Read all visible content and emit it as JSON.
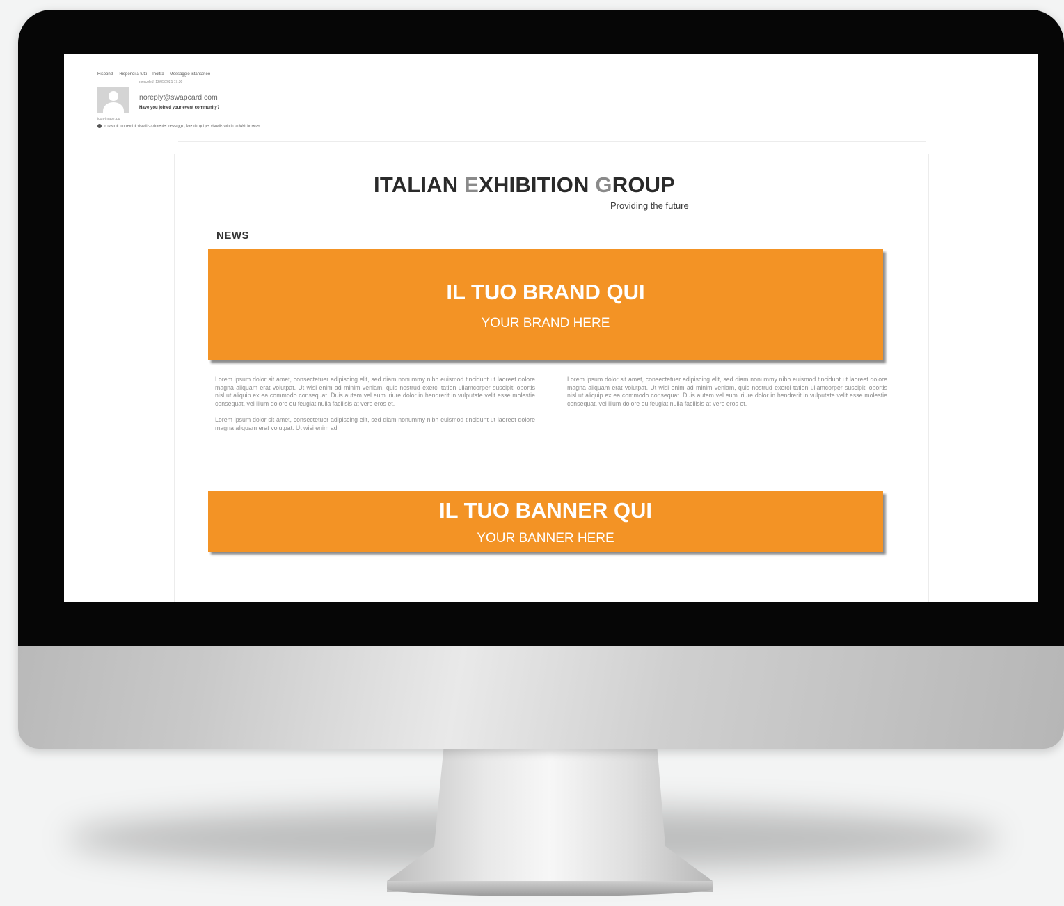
{
  "mail": {
    "toolbar": [
      "Rispondi",
      "Rispondi a tutti",
      "Inoltra",
      "Messaggio istantaneo"
    ],
    "date": "mercoledì 12/05/2021 17:30",
    "sender": "noreply@swapcard.com",
    "subject": "Have you joined your event community?",
    "attachment": "icon-image.jpg",
    "info": "In caso di problemi di visualizzazione del messaggio, fare clic qui per visualizzarlo in un Web browser."
  },
  "newsletter": {
    "logo": {
      "part1": "ITALIAN ",
      "letter_e": "E",
      "part2": "XHIBITION ",
      "letter_g": "G",
      "part3": "ROUP",
      "tagline": "Providing the future"
    },
    "section_title": "NEWS",
    "brand_banner": {
      "title": "IL TUO BRAND QUI",
      "subtitle": "YOUR BRAND HERE"
    },
    "columns": {
      "left_p1": "Lorem ipsum dolor sit amet, consectetuer adipiscing elit, sed diam nonummy nibh euismod tincidunt ut laoreet dolore magna aliquam erat volutpat. Ut wisi enim ad minim veniam, quis nostrud exerci tation ullamcorper suscipit lobortis nisl ut aliquip ex ea commodo consequat. Duis autem vel eum iriure dolor in hendrerit in vulputate velit esse molestie consequat, vel illum dolore eu feugiat nulla facilisis at vero eros et.",
      "left_p2": "Lorem ipsum dolor sit amet, consectetuer adipiscing elit, sed diam nonummy nibh euismod tincidunt ut laoreet dolore magna aliquam erat volutpat. Ut wisi enim ad",
      "right_p1": "Lorem ipsum dolor sit amet, consectetuer adipiscing elit, sed diam nonummy nibh euismod tincidunt ut laoreet dolore magna aliquam erat volutpat. Ut wisi enim ad minim veniam, quis nostrud exerci tation ullamcorper suscipit lobortis nisl ut aliquip ex ea commodo consequat. Duis autem vel eum iriure dolor in hendrerit in vulputate velit esse molestie consequat, vel illum dolore eu feugiat nulla facilisis at vero eros et."
    },
    "banner": {
      "title": "IL TUO BANNER QUI",
      "subtitle": "YOUR BANNER HERE"
    },
    "colors": {
      "accent": "#f39325",
      "bezel": "#060606"
    }
  }
}
